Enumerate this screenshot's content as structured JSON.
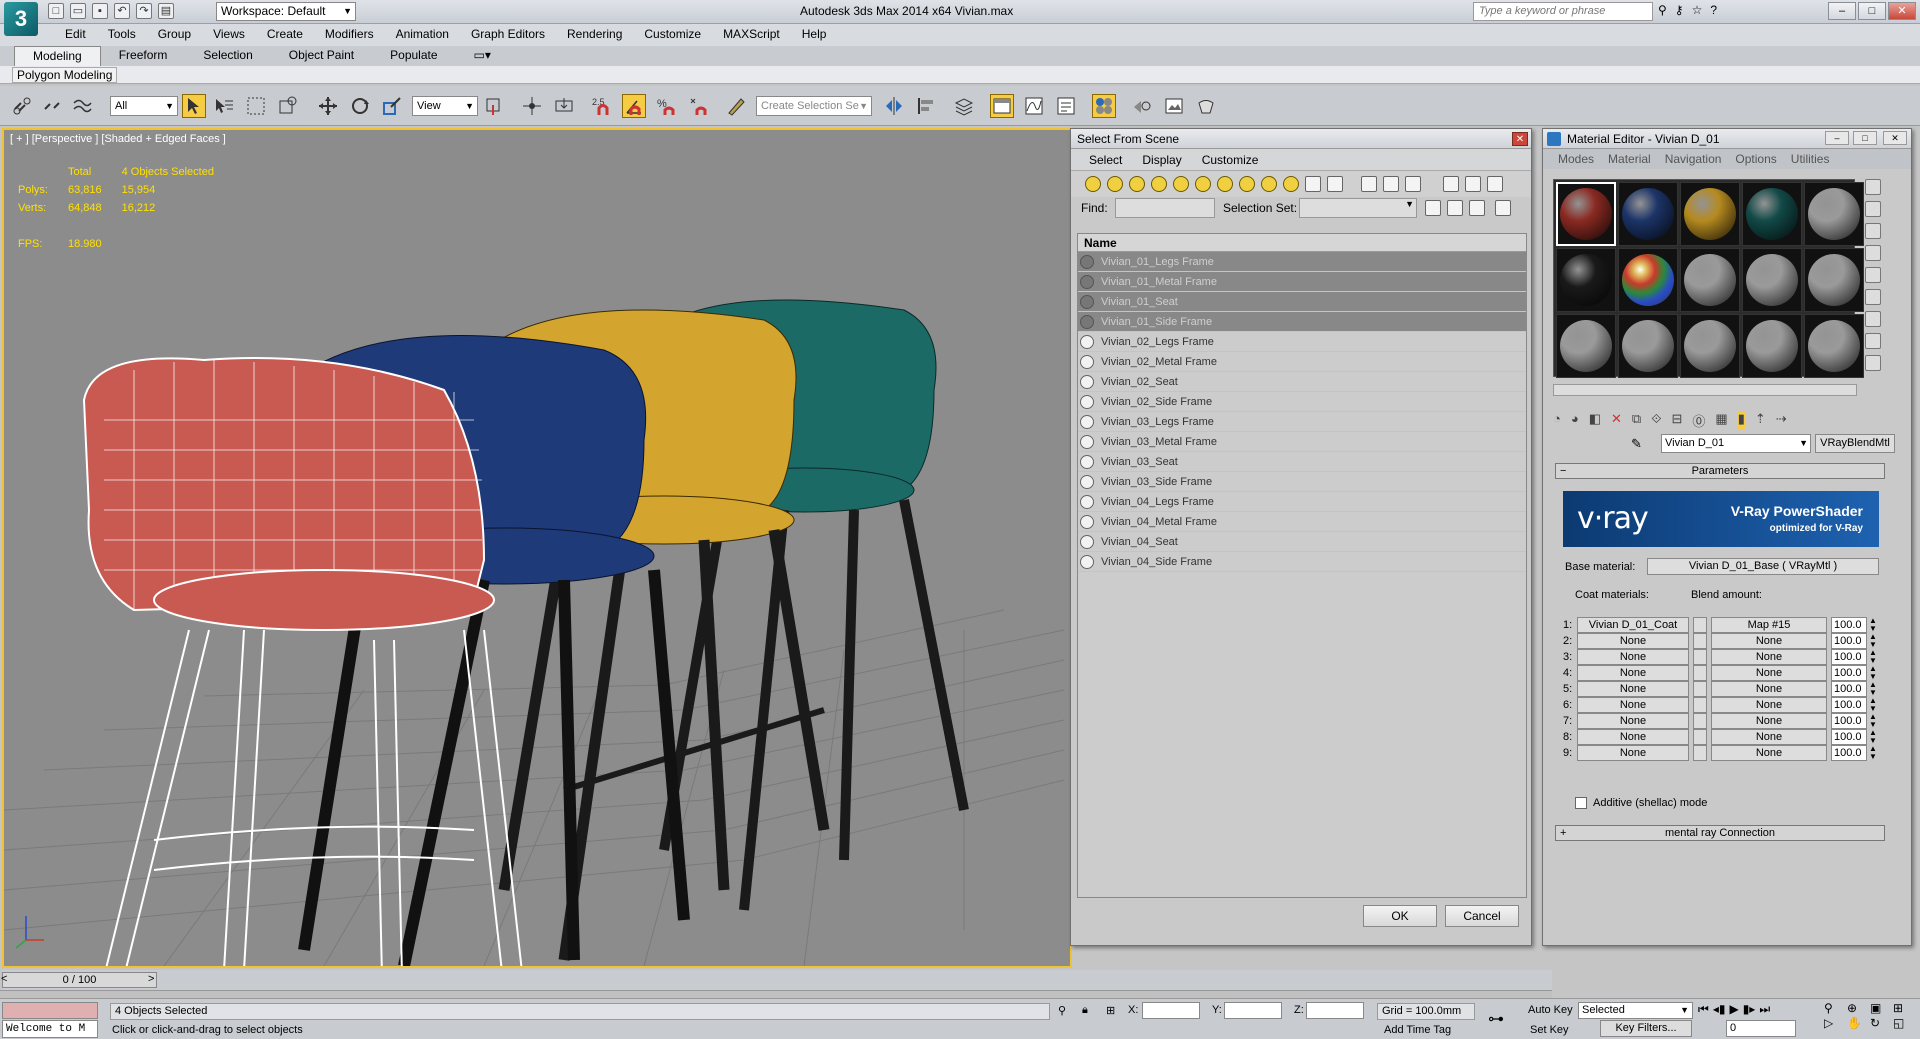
{
  "titlebar": {
    "logo": "3",
    "workspace": "Workspace: Default",
    "title": "Autodesk 3ds Max  2014 x64      Vivian.max",
    "search_placeholder": "Type a keyword or phrase"
  },
  "menu": [
    "Edit",
    "Tools",
    "Group",
    "Views",
    "Create",
    "Modifiers",
    "Animation",
    "Graph Editors",
    "Rendering",
    "Customize",
    "MAXScript",
    "Help"
  ],
  "ribbon": {
    "tabs": [
      "Modeling",
      "Freeform",
      "Selection",
      "Object Paint",
      "Populate"
    ],
    "panel_label": "Polygon Modeling"
  },
  "toolbar": {
    "filter": "All",
    "ref_coord": "View",
    "snap_value": "2.5",
    "selection_set_placeholder": "Create Selection Se"
  },
  "viewport": {
    "label": "[ + ] [Perspective ] [Shaded + Edged Faces ]",
    "stats": {
      "total_label": "Total",
      "selected_label": "4 Objects Selected",
      "polys_label": "Polys:",
      "polys_total": "63,816",
      "polys_sel": "15,954",
      "verts_label": "Verts:",
      "verts_total": "64,848",
      "verts_sel": "16,212",
      "fps_label": "FPS:",
      "fps": "18.980"
    },
    "chairs": [
      {
        "color": "#c85a52",
        "name": "red"
      },
      {
        "color": "#1f3a78",
        "name": "blue"
      },
      {
        "color": "#d4a52e",
        "name": "yellow"
      },
      {
        "color": "#1c6a66",
        "name": "teal"
      }
    ]
  },
  "timeslider": {
    "frame": "0 / 100",
    "left": "<",
    "right": ">"
  },
  "status": {
    "welcome": "Welcome to M",
    "selection": "4 Objects Selected",
    "prompt": "Click or click-and-drag to select objects",
    "x_label": "X:",
    "y_label": "Y:",
    "z_label": "Z:",
    "grid": "Grid = 100.0mm",
    "add_time_tag": "Add Time Tag",
    "auto_key": "Auto Key",
    "set_key": "Set Key",
    "selected": "Selected",
    "key_filters": "Key Filters...",
    "frame": "0"
  },
  "sfs": {
    "title": "Select From Scene",
    "menu": [
      "Select",
      "Display",
      "Customize"
    ],
    "find_label": "Find:",
    "selset_label": "Selection Set:",
    "col_name": "Name",
    "items": [
      {
        "name": "Vivian_01_Legs Frame",
        "selected": true
      },
      {
        "name": "Vivian_01_Metal Frame",
        "selected": true
      },
      {
        "name": "Vivian_01_Seat",
        "selected": true
      },
      {
        "name": "Vivian_01_Side Frame",
        "selected": true
      },
      {
        "name": "Vivian_02_Legs Frame",
        "selected": false
      },
      {
        "name": "Vivian_02_Metal Frame",
        "selected": false
      },
      {
        "name": "Vivian_02_Seat",
        "selected": false
      },
      {
        "name": "Vivian_02_Side Frame",
        "selected": false
      },
      {
        "name": "Vivian_03_Legs Frame",
        "selected": false
      },
      {
        "name": "Vivian_03_Metal Frame",
        "selected": false
      },
      {
        "name": "Vivian_03_Seat",
        "selected": false
      },
      {
        "name": "Vivian_03_Side Frame",
        "selected": false
      },
      {
        "name": "Vivian_04_Legs Frame",
        "selected": false
      },
      {
        "name": "Vivian_04_Metal Frame",
        "selected": false
      },
      {
        "name": "Vivian_04_Seat",
        "selected": false
      },
      {
        "name": "Vivian_04_Side Frame",
        "selected": false
      }
    ],
    "ok": "OK",
    "cancel": "Cancel"
  },
  "me": {
    "title": "Material Editor - Vivian D_01",
    "menu": [
      "Modes",
      "Material",
      "Navigation",
      "Options",
      "Utilities"
    ],
    "slots": [
      "#8a2a22",
      "#1c3468",
      "#b58a20",
      "#124a48",
      "#9a9a9a",
      "#1a1a1a",
      "#multi",
      "#9a9a9a",
      "#9a9a9a",
      "#9a9a9a",
      "#9a9a9a",
      "#9a9a9a",
      "#9a9a9a",
      "#9a9a9a",
      "#9a9a9a"
    ],
    "material_name": "Vivian D_01",
    "material_type": "VRayBlendMtl",
    "parameters": "Parameters",
    "vray_logo": "v·ray",
    "vray_title": "V-Ray PowerShader",
    "vray_sub": "optimized for V-Ray",
    "base_label": "Base material:",
    "base_value": "Vivian D_01_Base  ( VRayMtl )",
    "coat_label": "Coat materials:",
    "blend_label": "Blend amount:",
    "coats": [
      {
        "n": "1:",
        "mat": "Vivian D_01_Coat",
        "map": "Map #15",
        "amt": "100.0"
      },
      {
        "n": "2:",
        "mat": "None",
        "map": "None",
        "amt": "100.0"
      },
      {
        "n": "3:",
        "mat": "None",
        "map": "None",
        "amt": "100.0"
      },
      {
        "n": "4:",
        "mat": "None",
        "map": "None",
        "amt": "100.0"
      },
      {
        "n": "5:",
        "mat": "None",
        "map": "None",
        "amt": "100.0"
      },
      {
        "n": "6:",
        "mat": "None",
        "map": "None",
        "amt": "100.0"
      },
      {
        "n": "7:",
        "mat": "None",
        "map": "None",
        "amt": "100.0"
      },
      {
        "n": "8:",
        "mat": "None",
        "map": "None",
        "amt": "100.0"
      },
      {
        "n": "9:",
        "mat": "None",
        "map": "None",
        "amt": "100.0"
      }
    ],
    "additive": "Additive (shellac) mode",
    "mr_connection": "mental ray Connection"
  }
}
